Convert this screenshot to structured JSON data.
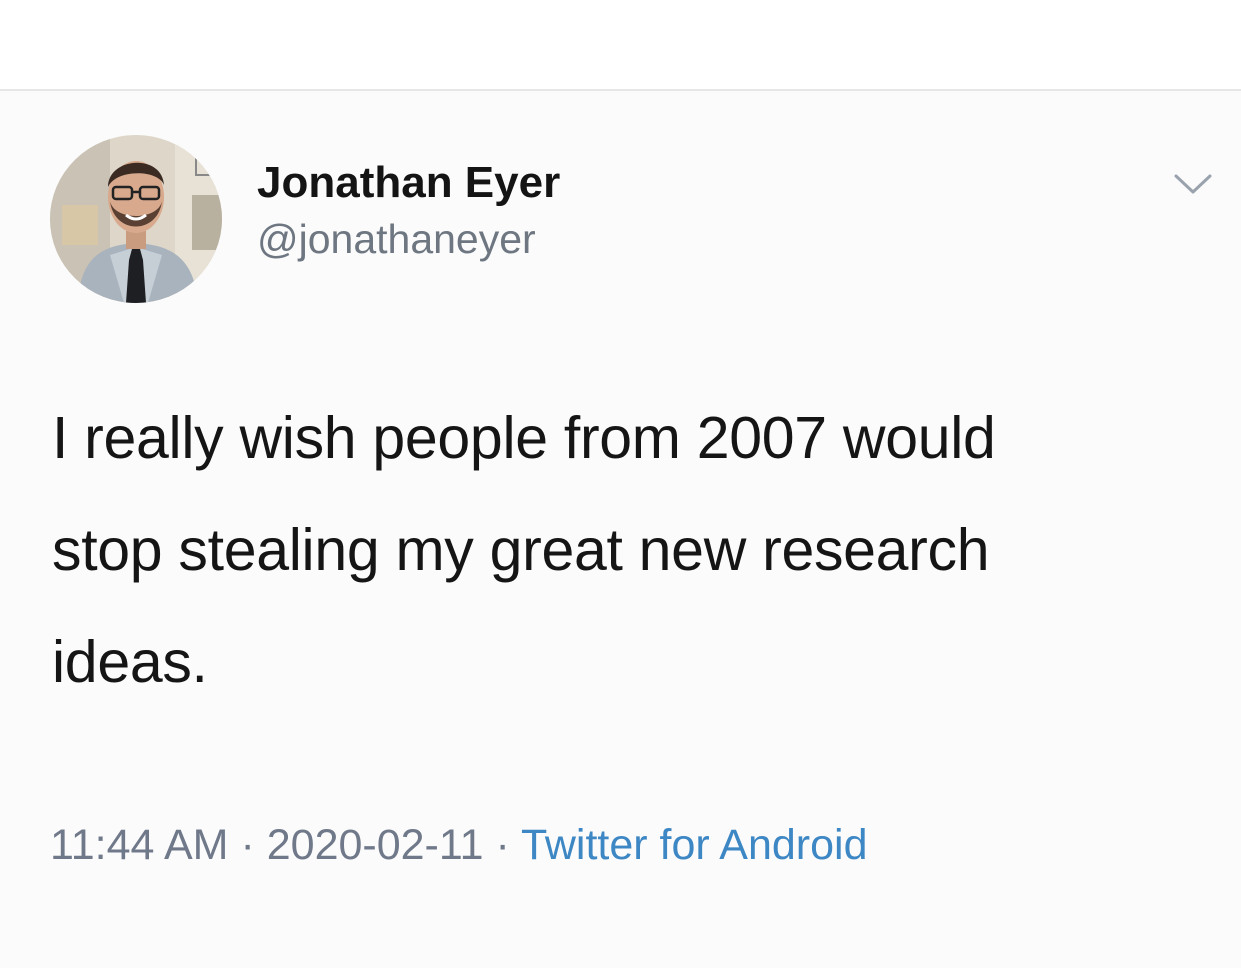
{
  "tweet": {
    "author": {
      "display_name": "Jonathan Eyer",
      "handle": "@jonathaneyer"
    },
    "text_lines": [
      "I really wish people from 2007 would",
      "stop stealing my great new research",
      "ideas."
    ],
    "meta": {
      "time": "11:44 AM",
      "separator": "·",
      "date": "2020-02-11",
      "source": "Twitter for Android"
    },
    "menu_icon": "chevron-down-icon"
  },
  "colors": {
    "text_primary": "#151515",
    "text_secondary": "#6e7781",
    "link": "#3d87c4",
    "divider": "#e6e6e6"
  }
}
